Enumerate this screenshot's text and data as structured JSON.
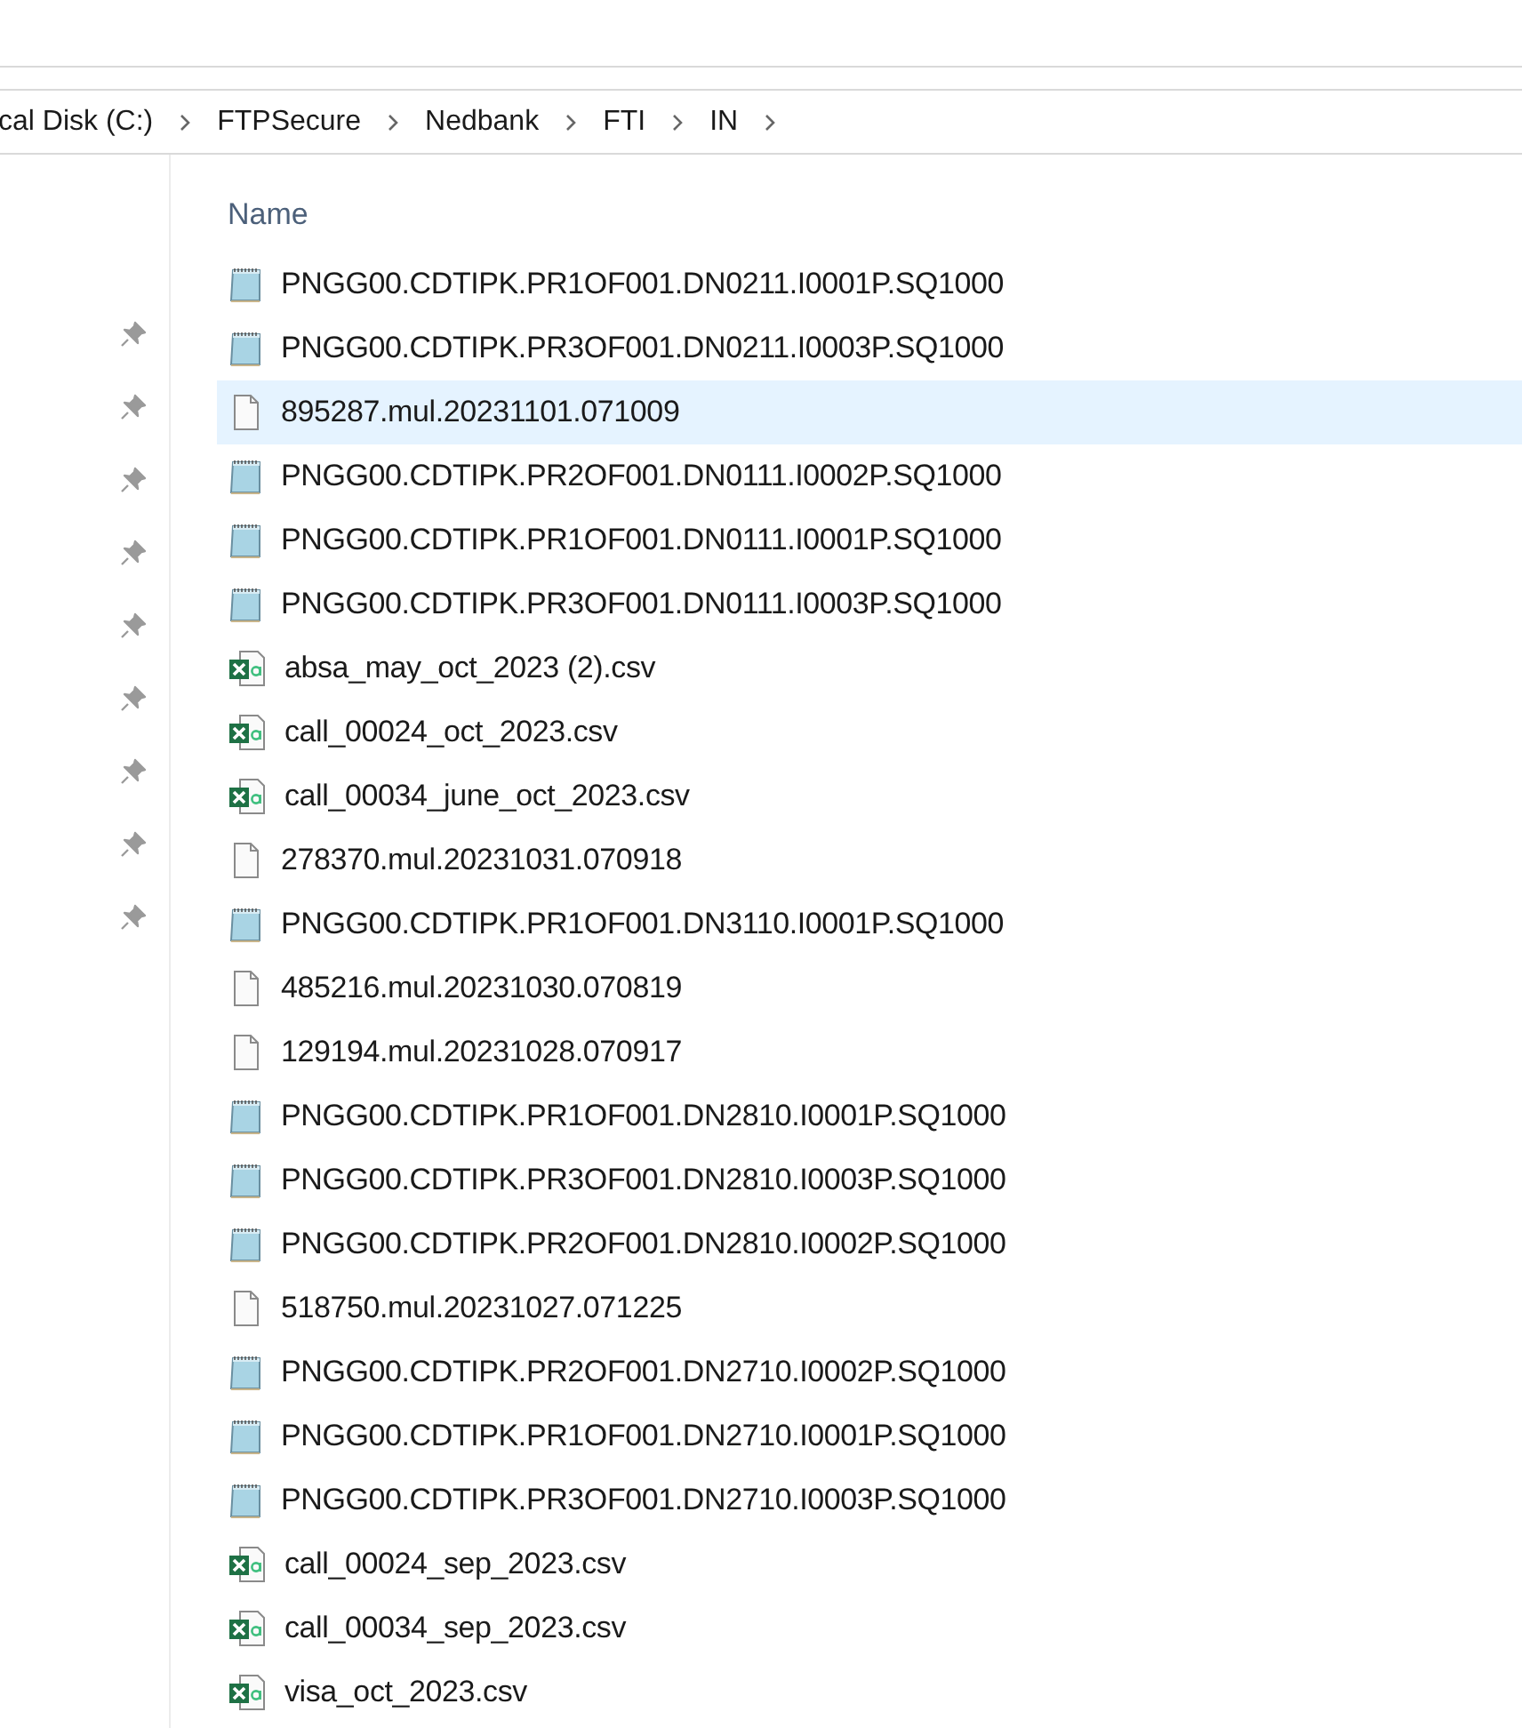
{
  "breadcrumb": [
    "cal Disk (C:)",
    "FTPSecure",
    "Nedbank",
    "FTI",
    "IN"
  ],
  "nav_pane": {
    "pins": [
      {
        "pinned": true
      },
      {
        "pinned": true
      },
      {
        "pinned": true
      },
      {
        "pinned": true
      },
      {
        "pinned": true
      },
      {
        "pinned": true
      },
      {
        "pinned": true
      },
      {
        "pinned": true
      },
      {
        "pinned": true
      }
    ]
  },
  "columns": [
    "Name"
  ],
  "files": [
    {
      "name": "PNGG00.CDTIPK.PR1OF001.DN0211.I0001P.SQ1000",
      "kind": "notepad",
      "selected": false
    },
    {
      "name": "PNGG00.CDTIPK.PR3OF001.DN0211.I0003P.SQ1000",
      "kind": "notepad",
      "selected": false
    },
    {
      "name": "895287.mul.20231101.071009",
      "kind": "blank",
      "selected": true
    },
    {
      "name": "PNGG00.CDTIPK.PR2OF001.DN0111.I0002P.SQ1000",
      "kind": "notepad",
      "selected": false
    },
    {
      "name": "PNGG00.CDTIPK.PR1OF001.DN0111.I0001P.SQ1000",
      "kind": "notepad",
      "selected": false
    },
    {
      "name": "PNGG00.CDTIPK.PR3OF001.DN0111.I0003P.SQ1000",
      "kind": "notepad",
      "selected": false
    },
    {
      "name": "absa_may_oct_2023 (2).csv",
      "kind": "excel",
      "selected": false
    },
    {
      "name": "call_00024_oct_2023.csv",
      "kind": "excel",
      "selected": false
    },
    {
      "name": "call_00034_june_oct_2023.csv",
      "kind": "excel",
      "selected": false
    },
    {
      "name": "278370.mul.20231031.070918",
      "kind": "blank",
      "selected": false
    },
    {
      "name": "PNGG00.CDTIPK.PR1OF001.DN3110.I0001P.SQ1000",
      "kind": "notepad",
      "selected": false
    },
    {
      "name": "485216.mul.20231030.070819",
      "kind": "blank",
      "selected": false
    },
    {
      "name": "129194.mul.20231028.070917",
      "kind": "blank",
      "selected": false
    },
    {
      "name": "PNGG00.CDTIPK.PR1OF001.DN2810.I0001P.SQ1000",
      "kind": "notepad",
      "selected": false
    },
    {
      "name": "PNGG00.CDTIPK.PR3OF001.DN2810.I0003P.SQ1000",
      "kind": "notepad",
      "selected": false
    },
    {
      "name": "PNGG00.CDTIPK.PR2OF001.DN2810.I0002P.SQ1000",
      "kind": "notepad",
      "selected": false
    },
    {
      "name": "518750.mul.20231027.071225",
      "kind": "blank",
      "selected": false
    },
    {
      "name": "PNGG00.CDTIPK.PR2OF001.DN2710.I0002P.SQ1000",
      "kind": "notepad",
      "selected": false
    },
    {
      "name": "PNGG00.CDTIPK.PR1OF001.DN2710.I0001P.SQ1000",
      "kind": "notepad",
      "selected": false
    },
    {
      "name": "PNGG00.CDTIPK.PR3OF001.DN2710.I0003P.SQ1000",
      "kind": "notepad",
      "selected": false
    },
    {
      "name": "call_00024_sep_2023.csv",
      "kind": "excel",
      "selected": false
    },
    {
      "name": "call_00034_sep_2023.csv",
      "kind": "excel",
      "selected": false
    },
    {
      "name": "visa_oct_2023.csv",
      "kind": "excel",
      "selected": false
    }
  ]
}
